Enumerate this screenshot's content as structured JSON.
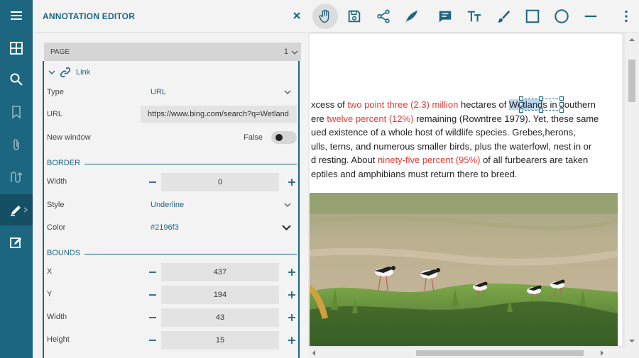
{
  "app": {
    "title": "ANNOTATION EDITOR"
  },
  "colors": {
    "accent": "#1d6680",
    "red_text": "#e53935",
    "selection": "#bcd6f2"
  },
  "rail": {
    "items": [
      {
        "name": "menu-icon"
      },
      {
        "name": "thumbnails-icon"
      },
      {
        "name": "search-icon"
      },
      {
        "name": "bookmark-icon"
      },
      {
        "name": "attachment-icon"
      },
      {
        "name": "signature-icon"
      },
      {
        "name": "annotation-edit-icon",
        "active": true
      },
      {
        "name": "form-edit-icon"
      }
    ]
  },
  "toolbar": {
    "tools": [
      "pan-icon",
      "save-icon",
      "share-icon",
      "pen-icon",
      "comment-icon",
      "text-icon",
      "brush-icon",
      "rectangle-icon",
      "circle-icon",
      "line-icon",
      "more-icon"
    ],
    "active_tool": "pan-icon"
  },
  "panel": {
    "page_label": "PAGE",
    "page_number": "1",
    "link_header": "Link",
    "type_label": "Type",
    "type_value": "URL",
    "url_label": "URL",
    "url_value": "https://www.bing.com/search?q=Wetland",
    "new_window_label": "New window",
    "new_window_value": "False",
    "border_section": "BORDER",
    "border_width_label": "Width",
    "border_width_value": "0",
    "style_label": "Style",
    "style_value": "Underline",
    "color_label": "Color",
    "color_value": "#2196f3",
    "bounds_section": "BOUNDS",
    "x_label": "X",
    "x_value": "437",
    "y_label": "Y",
    "y_value": "194",
    "width_label": "Width",
    "width_value": "43",
    "height_label": "Height",
    "height_value": "15"
  },
  "document": {
    "l1a": "xcess of ",
    "l1b": "two point three (2.3) million",
    "l1c": " hectares of ",
    "l1d": "Wetland",
    "l1e": "s in southern",
    "l2a": "ere ",
    "l2b": "twelve percent (12%)",
    "l2c": " remaining (Rowntree 1979). Yet, these same",
    "l3": "ued existence of a whole host of wildlife species. Grebes,herons,",
    "l4": "ulls, terns, and numerous smaller birds, plus the waterfowl, nest in or",
    "l5a": "d resting. About ",
    "l5b": "ninety-five percent (95%)",
    "l5c": " of all furbearers are taken",
    "l6": "eptiles and amphibians must return there to breed."
  }
}
